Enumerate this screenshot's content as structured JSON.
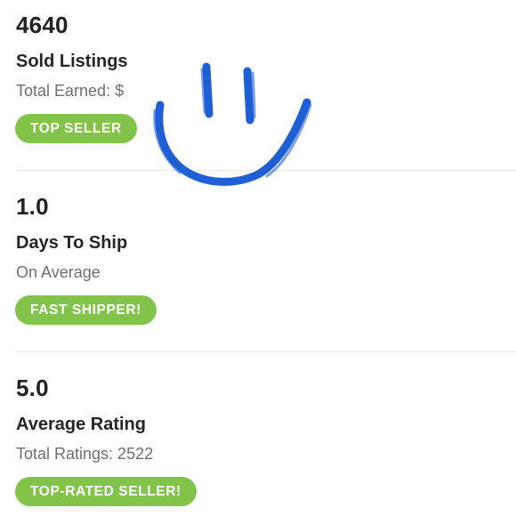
{
  "stats": [
    {
      "value": "4640",
      "label": "Sold Listings",
      "sub": "Total Earned: $",
      "badge": "TOP SELLER"
    },
    {
      "value": "1.0",
      "label": "Days To Ship",
      "sub": "On Average",
      "badge": "FAST SHIPPER!"
    },
    {
      "value": "5.0",
      "label": "Average Rating",
      "sub": "Total Ratings: 2522",
      "badge": "TOP-RATED SELLER!"
    }
  ],
  "colors": {
    "badge": "#82c44a",
    "doodle": "#1f5fd6"
  },
  "overlay": {
    "icon": "smiley-face-icon"
  }
}
